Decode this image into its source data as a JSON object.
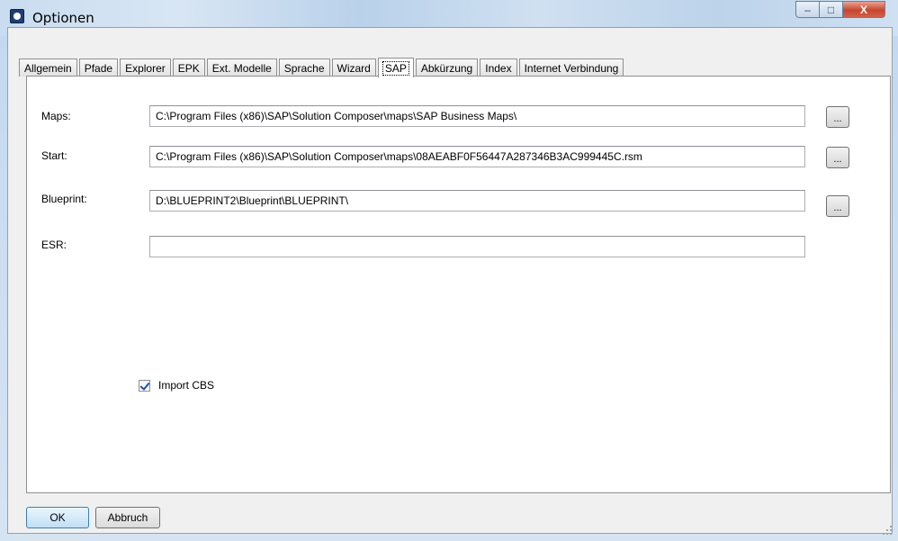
{
  "window": {
    "title": "Optionen",
    "controls": {
      "minimize": "–",
      "maximize": "□",
      "close": "X"
    }
  },
  "tabs": [
    {
      "label": "Allgemein",
      "active": false
    },
    {
      "label": "Pfade",
      "active": false
    },
    {
      "label": "Explorer",
      "active": false
    },
    {
      "label": "EPK",
      "active": false
    },
    {
      "label": "Ext. Modelle",
      "active": false
    },
    {
      "label": "Sprache",
      "active": false
    },
    {
      "label": "Wizard",
      "active": false
    },
    {
      "label": "SAP",
      "active": true
    },
    {
      "label": "Abkürzung",
      "active": false
    },
    {
      "label": "Index",
      "active": false
    },
    {
      "label": "Internet Verbindung",
      "active": false
    }
  ],
  "fields": {
    "maps": {
      "label": "Maps:",
      "value": "C:\\Program Files (x86)\\SAP\\Solution Composer\\maps\\SAP Business Maps\\",
      "browse": "..."
    },
    "start": {
      "label": "Start:",
      "value": "C:\\Program Files (x86)\\SAP\\Solution Composer\\maps\\08AEABF0F56447A287346B3AC999445C.rsm",
      "browse": "..."
    },
    "blueprint": {
      "label": "Blueprint:",
      "value": "D:\\BLUEPRINT2\\Blueprint\\BLUEPRINT\\",
      "browse": "..."
    },
    "esr": {
      "label": "ESR:",
      "value": ""
    }
  },
  "import_cbs": {
    "label": "Import CBS",
    "checked": true
  },
  "buttons": {
    "ok": "OK",
    "cancel": "Abbruch"
  }
}
